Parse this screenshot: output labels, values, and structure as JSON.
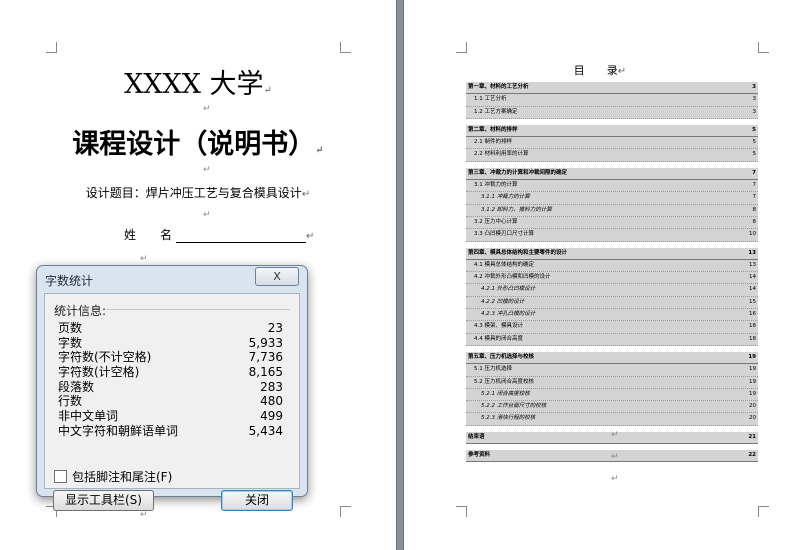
{
  "left_page": {
    "university": "XXXX 大学",
    "main_title": "课程设计（说明书）",
    "subtitle": "设计题目：焊片冲压工艺与复合模具设计",
    "name_label": "姓　　名"
  },
  "dialog": {
    "title": "字数统计",
    "close_x": "X",
    "group_label": "统计信息:",
    "stats": [
      {
        "label": "页数",
        "value": "23"
      },
      {
        "label": "字数",
        "value": "5,933"
      },
      {
        "label": "字符数(不计空格)",
        "value": "7,736"
      },
      {
        "label": "字符数(计空格)",
        "value": "8,165"
      },
      {
        "label": "段落数",
        "value": "283"
      },
      {
        "label": "行数",
        "value": "480"
      },
      {
        "label": "非中文单词",
        "value": "499"
      },
      {
        "label": "中文字符和朝鲜语单词",
        "value": "5,434"
      }
    ],
    "checkbox_label": "包括脚注和尾注(F)",
    "toolbar_button": "显示工具栏(S)",
    "close_button": "关闭"
  },
  "toc": {
    "heading": "目　　录",
    "entries": [
      {
        "level": 1,
        "text": "第一章、材料的工艺分析",
        "page": "3"
      },
      {
        "level": 2,
        "text": "1.1 工艺分析",
        "page": "3"
      },
      {
        "level": 2,
        "text": "1.2 工艺方案确定",
        "page": "3"
      },
      {
        "level": 1,
        "text": "第二章、材料的排样",
        "page": "5"
      },
      {
        "level": 2,
        "text": "2.1 制件的排样",
        "page": "5"
      },
      {
        "level": 2,
        "text": "2.2 材料利用率的计算",
        "page": "5"
      },
      {
        "level": 1,
        "text": "第三章、冲裁力的计算和冲裁间隙的确定",
        "page": "7"
      },
      {
        "level": 2,
        "text": "3.1 冲裁力的计算",
        "page": "7"
      },
      {
        "level": 3,
        "text": "3.1.1 冲裁力的计算",
        "page": "7"
      },
      {
        "level": 3,
        "text": "3.1.2 卸料力、推料力的计算",
        "page": "8"
      },
      {
        "level": 2,
        "text": "3.2 压力中心计算",
        "page": "8"
      },
      {
        "level": 2,
        "text": "3.3 凸凹模刃口尺寸计算",
        "page": "10"
      },
      {
        "level": 1,
        "text": "第四章、模具总体结构和主要零件的设计",
        "page": "13"
      },
      {
        "level": 2,
        "text": "4.1 模具总体结构的确定",
        "page": "13"
      },
      {
        "level": 2,
        "text": "4.2 冲裁外形凸模和凹模的设计",
        "page": "14"
      },
      {
        "level": 3,
        "text": "4.2.1 外形凸凹模设计",
        "page": "14"
      },
      {
        "level": 3,
        "text": "4.2.2 凹模的设计",
        "page": "15"
      },
      {
        "level": 3,
        "text": "4.2.3 冲孔凸模的设计",
        "page": "16"
      },
      {
        "level": 2,
        "text": "4.3 模架、模具设计",
        "page": "18"
      },
      {
        "level": 2,
        "text": "4.4 模具的闭合高度",
        "page": "18"
      },
      {
        "level": 1,
        "text": "第五章、压力机选择与校核",
        "page": "19"
      },
      {
        "level": 2,
        "text": "5.1 压力机选择",
        "page": "19"
      },
      {
        "level": 2,
        "text": "5.2 压力机闭合高度校核",
        "page": "19"
      },
      {
        "level": 3,
        "text": "5.2.1 闭合高度校核",
        "page": "19"
      },
      {
        "level": 3,
        "text": "5.2.2 工作台面尺寸的校核",
        "page": "20"
      },
      {
        "level": 3,
        "text": "5.2.3 滑块行程的校核",
        "page": "20"
      },
      {
        "level": 1,
        "text": "结束语",
        "page": "21"
      },
      {
        "level": 1,
        "text": "参考资料",
        "page": "22"
      }
    ]
  }
}
